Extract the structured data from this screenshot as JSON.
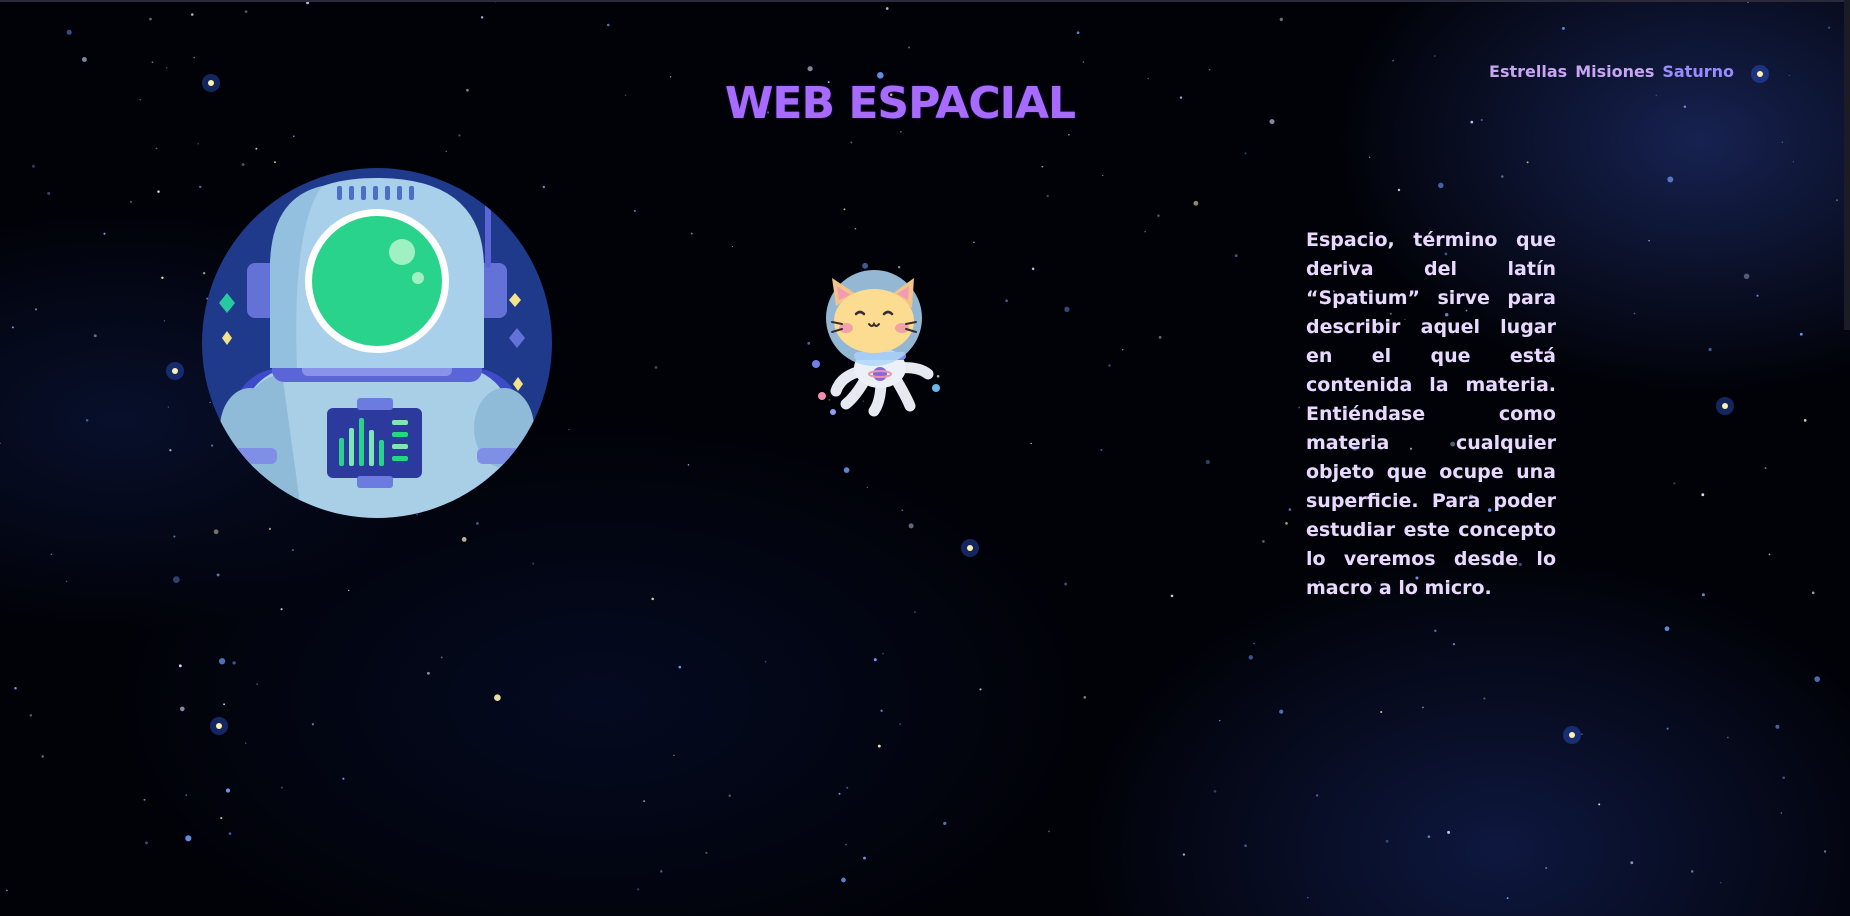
{
  "header": {
    "title": "WEB ESPACIAL",
    "nav": [
      "Estrellas",
      "Misiones",
      "Saturno"
    ]
  },
  "illustrations": {
    "astronaut": "astronaut-illustration",
    "cat": "cat-astronaut-illustration"
  },
  "main": {
    "description": "Espacio, término que deriva del latín “Spatium” sirve para describir aquel lugar en el que está contenida la materia. Entiéndase como materia cualquier objeto que ocupe una superficie. Para poder estudiar este concepto lo veremos desde lo macro a lo micro."
  },
  "colors": {
    "background": "#010208",
    "title": "#a86bff",
    "nav_text": "#c7a6f2",
    "body_text": "#ead9ff"
  }
}
